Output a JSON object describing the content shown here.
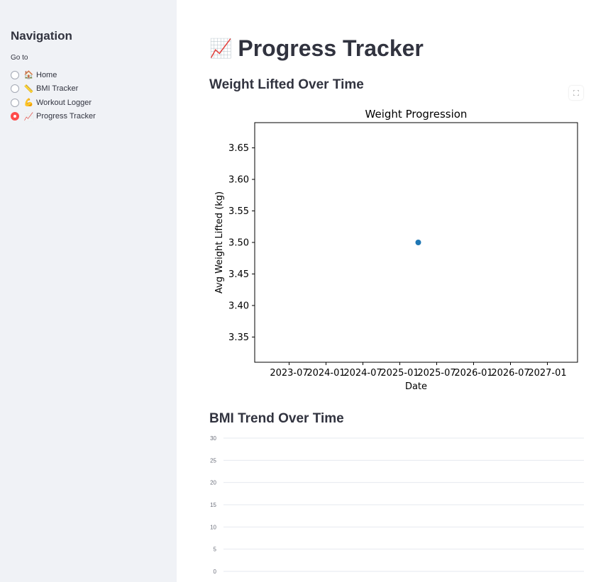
{
  "sidebar": {
    "title": "Navigation",
    "radio_label": "Go to",
    "items": [
      {
        "icon": "🏠",
        "icon_name": "house-icon",
        "label": "Home",
        "selected": false
      },
      {
        "icon": "📏",
        "icon_name": "ruler-icon",
        "label": "BMI Tracker",
        "selected": false
      },
      {
        "icon": "💪",
        "icon_name": "flexed-biceps-icon",
        "label": "Workout Logger",
        "selected": false
      },
      {
        "icon": "📈",
        "icon_name": "chart-increasing-icon",
        "label": "Progress Tracker",
        "selected": true
      }
    ],
    "accent_color": "#ff4b4b"
  },
  "main": {
    "title_icon": "📈",
    "title": "Progress Tracker",
    "section1_title": "Weight Lifted Over Time",
    "section2_title": "BMI Trend Over Time"
  },
  "chart_data": [
    {
      "type": "scatter",
      "title": "Weight Progression",
      "xlabel": "Date",
      "ylabel": "Avg Weight Lifted (kg)",
      "x_ticks": [
        "2023-07",
        "2024-01",
        "2024-07",
        "2025-01",
        "2025-07",
        "2026-01",
        "2026-07",
        "2027-01"
      ],
      "y_ticks": [
        "3.35",
        "3.40",
        "3.45",
        "3.50",
        "3.55",
        "3.60",
        "3.65"
      ],
      "ylim": [
        3.31,
        3.69
      ],
      "points": [
        {
          "x": "2025-04",
          "y": 3.5
        }
      ],
      "marker_color": "#1f77b4",
      "grid": false
    },
    {
      "type": "line",
      "title": "",
      "xlabel": "",
      "ylabel": "",
      "y_ticks": [
        "0",
        "5",
        "10",
        "15",
        "20",
        "25",
        "30"
      ],
      "ylim": [
        0,
        30
      ],
      "series": [],
      "grid": true
    }
  ]
}
